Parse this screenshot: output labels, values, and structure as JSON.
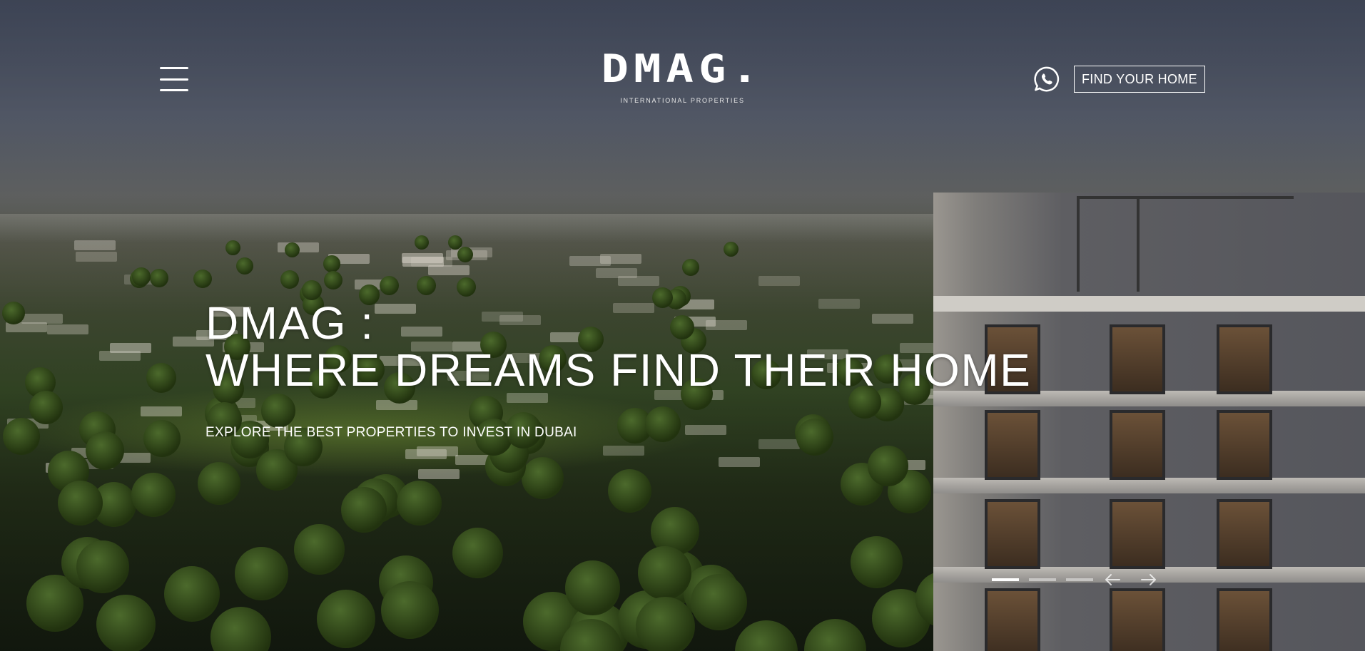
{
  "header": {
    "menu_icon": "hamburger-menu-icon",
    "logo_text": "DMAG.",
    "logo_subtitle": "INTERNATIONAL PROPERTIES",
    "whatsapp_icon": "whatsapp-icon",
    "find_home_label": "FIND YOUR HOME"
  },
  "hero": {
    "title_line1": "DMAG :",
    "title_line2": "WHERE DREAMS FIND THEIR HOME",
    "subtitle": "EXPLORE THE BEST PROPERTIES TO INVEST IN DUBAI"
  },
  "slider": {
    "active_index": 0,
    "slide_count": 3,
    "prev_icon": "arrow-left-icon",
    "next_icon": "arrow-right-icon"
  },
  "colors": {
    "text": "#ffffff",
    "inactive_dot": "rgba(255,255,255,0.45)"
  }
}
